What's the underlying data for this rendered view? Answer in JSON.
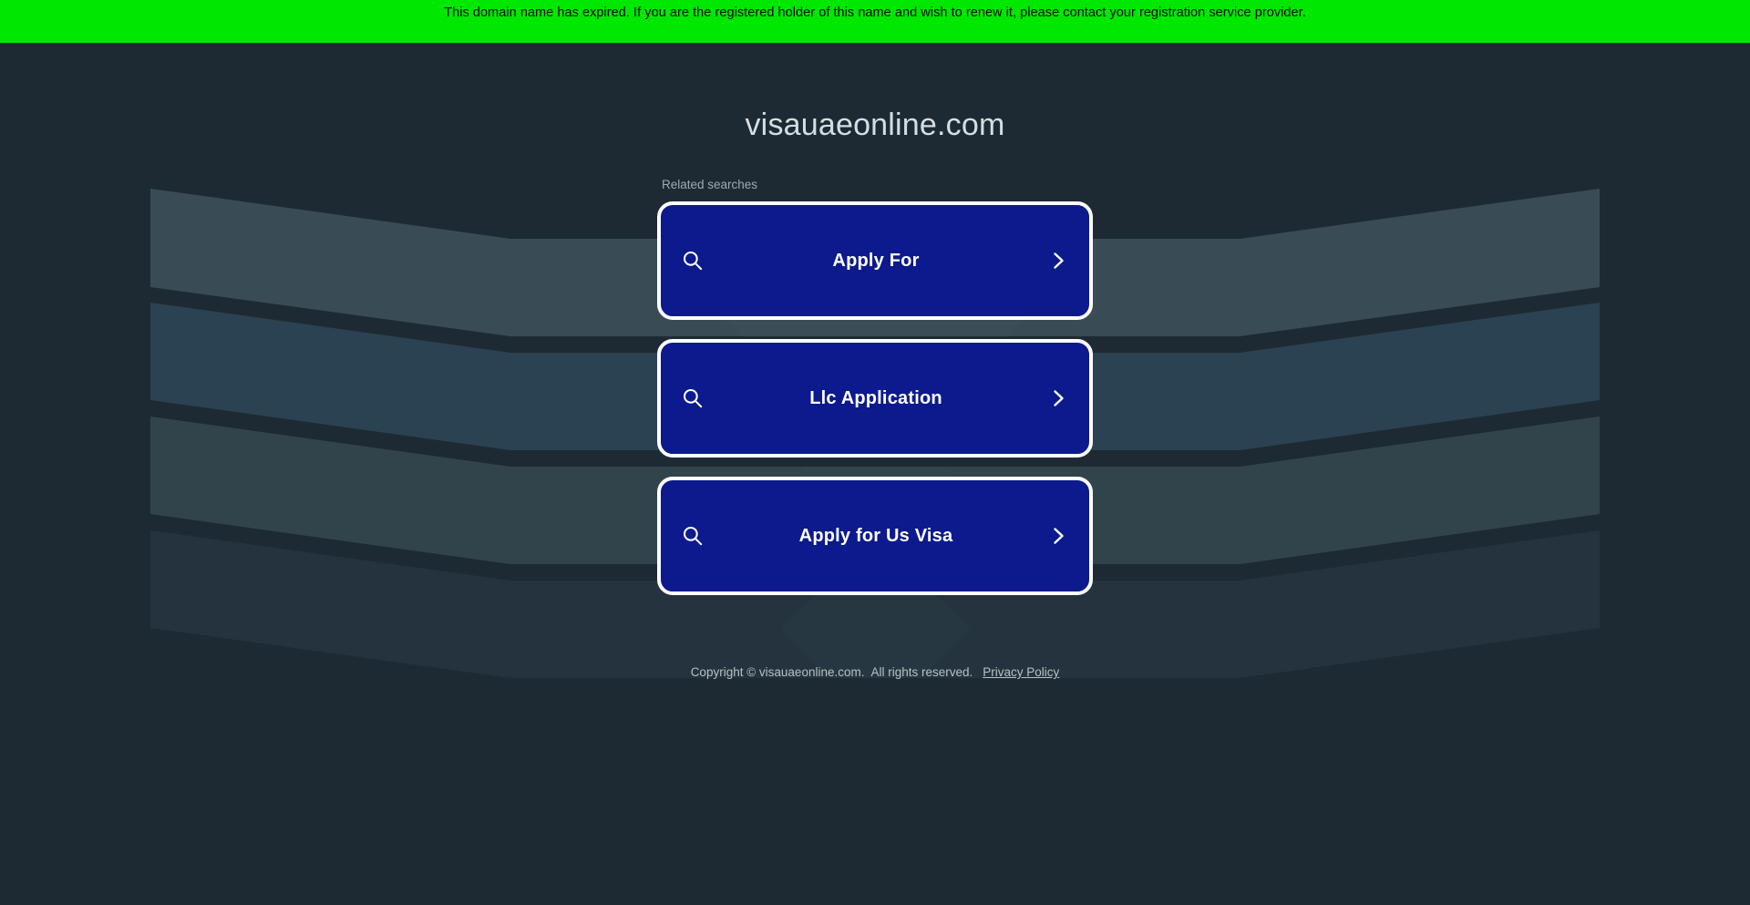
{
  "banner": {
    "message": "This domain name has expired. If you are the registered holder of this name and wish to renew it, please contact your registration service provider.",
    "background_color": "#00e800",
    "text_color": "#0a0a0a"
  },
  "page": {
    "domain_title": "visauaeonline.com",
    "background_color": "#1e2a33",
    "title_color": "#d6dde1"
  },
  "search": {
    "related_label": "Related searches",
    "card_fill_color": "#0c1a8e",
    "card_border_color": "#ffffff",
    "items": [
      {
        "label": "Apply For",
        "search_icon": "search-icon",
        "chevron_icon": "chevron-right-icon"
      },
      {
        "label": "Llc Application",
        "search_icon": "search-icon",
        "chevron_icon": "chevron-right-icon"
      },
      {
        "label": "Apply for Us Visa",
        "search_icon": "search-icon",
        "chevron_icon": "chevron-right-icon"
      }
    ]
  },
  "footer": {
    "copyright": "Copyright © visauaeonline.com.",
    "rights": "All rights reserved.",
    "privacy_link": "Privacy Policy"
  }
}
